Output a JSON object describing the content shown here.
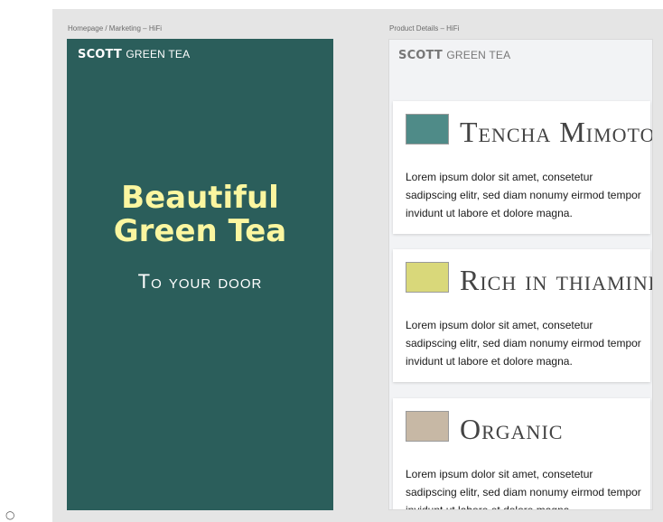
{
  "frames": [
    {
      "label": "Homepage / Marketing – HiFi"
    },
    {
      "label": "Product Details – HiFi"
    }
  ],
  "brand": {
    "bold": "SCOTT",
    "light": "GREEN TEA"
  },
  "hero": {
    "line1": "Beautiful",
    "line2": "Green Tea",
    "subtitle": "To your door"
  },
  "cards": [
    {
      "title": "Tencha Mimoto",
      "swatch_color": "#4f8b88",
      "body": "Lorem ipsum dolor sit amet, consetetur sadipscing elitr, sed diam nonumy eirmod tempor invidunt ut labore et dolore magna."
    },
    {
      "title": "Rich in thiamine",
      "swatch_color": "#d9d87a",
      "body": "Lorem ipsum dolor sit amet, consetetur sadipscing elitr, sed diam nonumy eirmod tempor invidunt ut labore et dolore magna."
    },
    {
      "title": "Organic",
      "swatch_color": "#c7b8a5",
      "body": "Lorem ipsum dolor sit amet, consetetur sadipscing elitr, sed diam nonumy eirmod tempor invidunt ut labore et dolore magna."
    }
  ],
  "colors": {
    "hero_bg": "#2b5e5b",
    "hero_title": "#fbf6a0",
    "canvas_bg": "#e5e5e5"
  },
  "corner_glyph": "○"
}
